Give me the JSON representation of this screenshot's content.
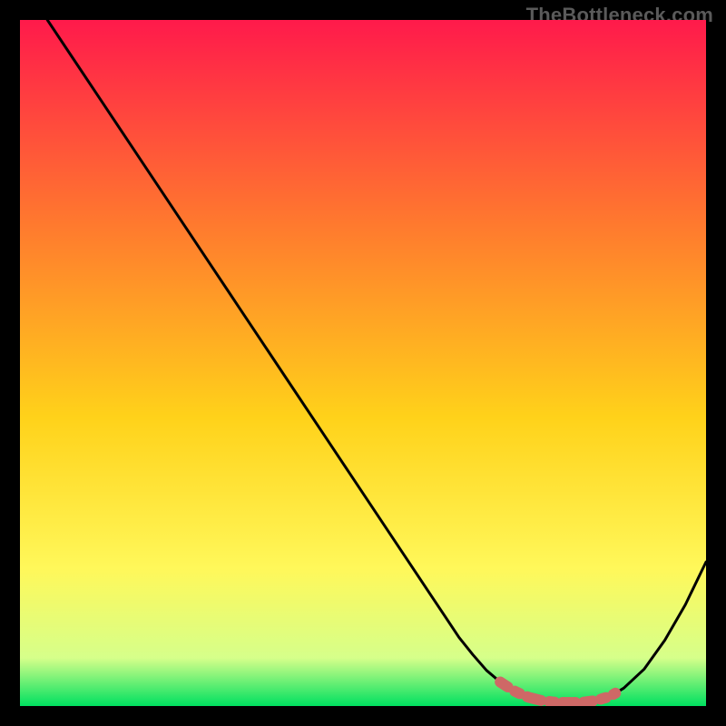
{
  "watermark": "TheBottleneck.com",
  "colors": {
    "gradient_top": "#ff1a4b",
    "gradient_upper_mid": "#ff7a2e",
    "gradient_mid": "#ffd21a",
    "gradient_lower_mid": "#fff85a",
    "gradient_bottom_light": "#d6ff8a",
    "gradient_bottom": "#00e060",
    "curve": "#000000",
    "marker_fill": "#d6706e",
    "marker_stroke": "#b64f4e"
  },
  "chart_data": {
    "type": "line",
    "title": "",
    "xlabel": "",
    "ylabel": "",
    "xlim": [
      0,
      100
    ],
    "ylim": [
      0,
      100
    ],
    "grid": false,
    "legend": false,
    "series": [
      {
        "name": "bottleneck-curve",
        "x": [
          4,
          8,
          12,
          16,
          20,
          24,
          28,
          32,
          36,
          40,
          44,
          48,
          52,
          56,
          60,
          62,
          64,
          66,
          68,
          70,
          72,
          74,
          76,
          78,
          80,
          82,
          84,
          86,
          88,
          91,
          94,
          97,
          100
        ],
        "y": [
          100,
          94,
          88,
          82,
          76,
          70,
          64,
          58,
          52,
          46,
          40,
          34,
          28,
          22,
          16,
          13,
          10,
          7.5,
          5.2,
          3.5,
          2.2,
          1.3,
          0.8,
          0.55,
          0.5,
          0.55,
          0.8,
          1.4,
          2.6,
          5.4,
          9.6,
          14.8,
          21
        ]
      }
    ],
    "markers": {
      "name": "optimal-range-markers",
      "x_start": 70,
      "x_end": 87,
      "style": "dashed-band"
    }
  }
}
